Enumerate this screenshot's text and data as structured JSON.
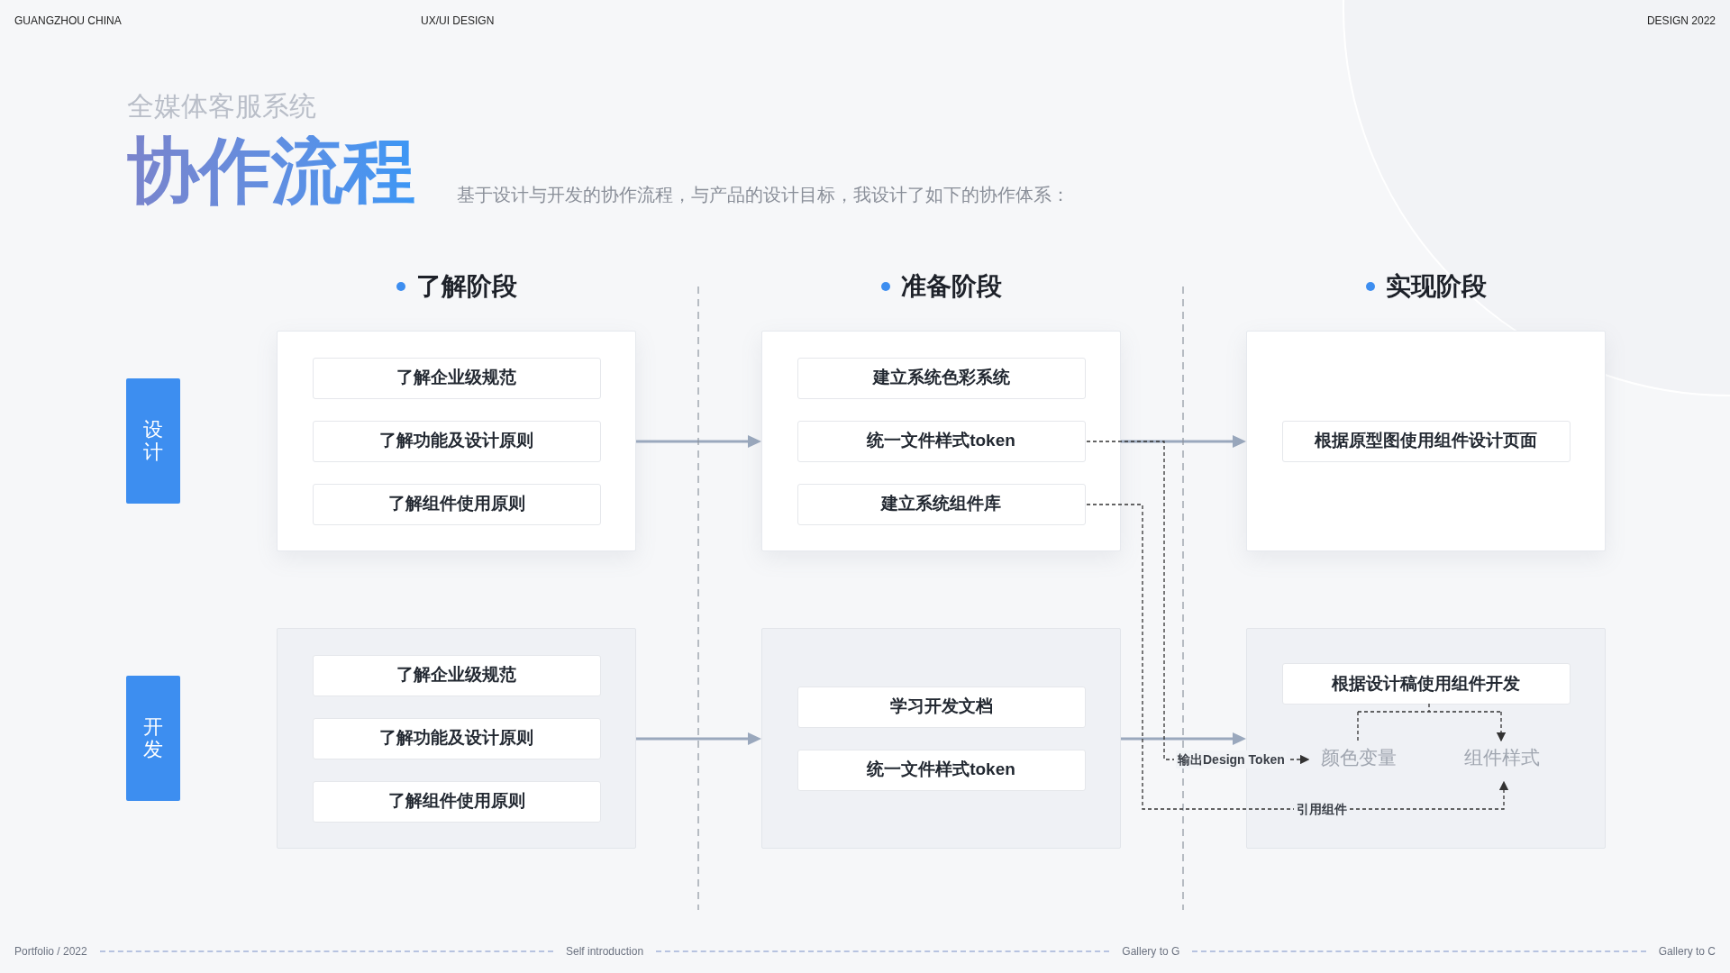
{
  "header": {
    "left": "GUANGZHOU CHINA",
    "center": "UX/UI DESIGN",
    "right": "DESIGN 2022"
  },
  "subtitle": "全媒体客服系统",
  "title": "协作流程",
  "description": "基于设计与开发的协作流程，与产品的设计目标，我设计了如下的协作体系：",
  "phases": [
    "了解阶段",
    "准备阶段",
    "实现阶段"
  ],
  "lanes": [
    {
      "label": "设计",
      "kind": "design",
      "cards": [
        {
          "items": [
            "了解企业级规范",
            "了解功能及设计原则",
            "了解组件使用原则"
          ]
        },
        {
          "items": [
            "建立系统色彩系统",
            "统一文件样式token",
            "建立系统组件库"
          ]
        },
        {
          "items": [
            "根据原型图使用组件设计页面"
          ]
        }
      ]
    },
    {
      "label": "开发",
      "kind": "dev",
      "cards": [
        {
          "items": [
            "了解企业级规范",
            "了解功能及设计原则",
            "了解组件使用原则"
          ]
        },
        {
          "items": [
            "学习开发文档",
            "统一文件样式token"
          ]
        },
        {
          "items": [
            "根据设计稿使用组件开发"
          ],
          "outputs": [
            "颜色变量",
            "组件样式"
          ]
        }
      ]
    }
  ],
  "connectors": [
    {
      "label": "输出Design Token"
    },
    {
      "label": "引用组件"
    }
  ],
  "footer": [
    "Portfolio / 2022",
    "Self introduction",
    "Gallery to G",
    "Gallery to C"
  ]
}
